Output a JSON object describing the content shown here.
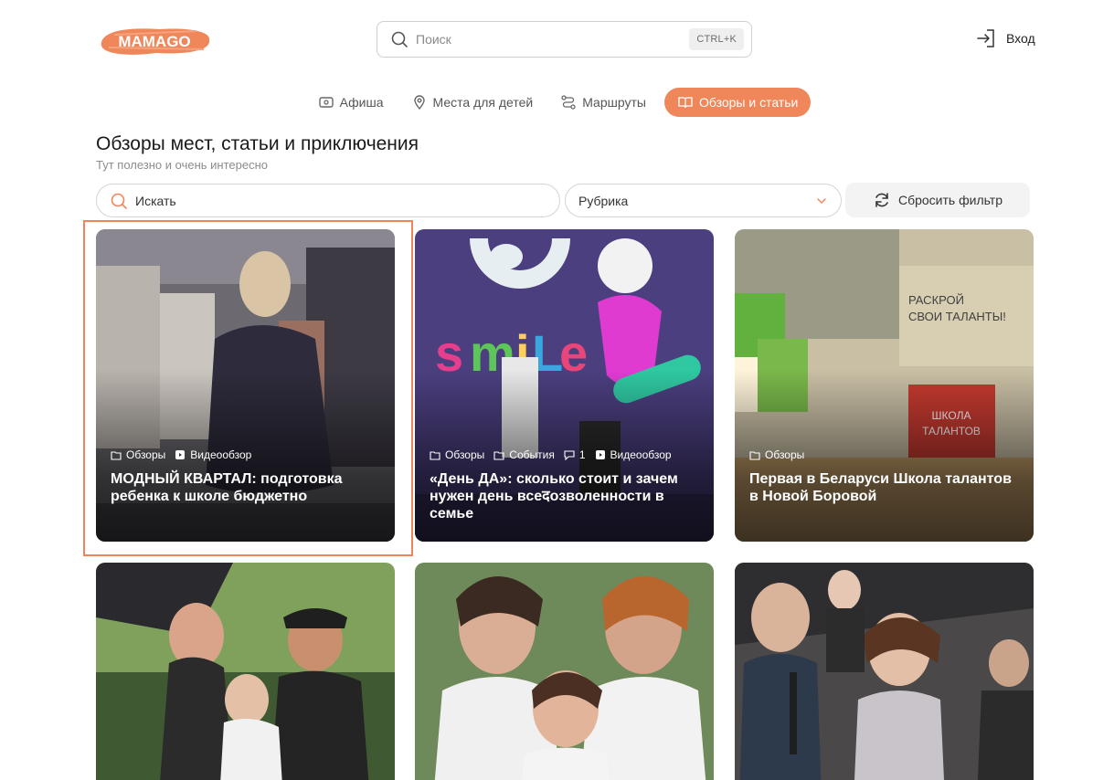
{
  "logo": {
    "text": "MAMAGO"
  },
  "search": {
    "placeholder": "Поиск",
    "shortcut": "CTRL+K"
  },
  "auth": {
    "login_label": "Вход"
  },
  "nav": {
    "tabs": [
      {
        "label": "Афиша",
        "icon": "ticket-icon",
        "active": false
      },
      {
        "label": "Места для детей",
        "icon": "map-pin-icon",
        "active": false
      },
      {
        "label": "Маршруты",
        "icon": "route-icon",
        "active": false
      },
      {
        "label": "Обзоры и статьи",
        "icon": "book-icon",
        "active": true
      }
    ]
  },
  "page": {
    "title": "Обзоры мест, статьи и приключения",
    "subtitle": "Тут полезно и очень интересно"
  },
  "filters": {
    "search_value": "Искать",
    "rubric_value": "Рубрика",
    "reset_label": "Сбросить фильтр"
  },
  "colors": {
    "accent": "#f0875a",
    "highlight": "#ee8457"
  },
  "cards": [
    {
      "tags": [
        "Обзоры",
        "Видеообзор"
      ],
      "title": "МОДНЫЙ КВАРТАЛ: подготовка ребенка к школе бюджетно"
    },
    {
      "tags": [
        "Обзоры",
        "События",
        "1",
        "Видеообзор"
      ],
      "title": "«День ДА»: сколько стоит и зачем нужен день всеदозволенности в семье"
    },
    {
      "tags": [
        "Обзоры"
      ],
      "title": "Первая в Беларуси Школа талантов в Новой Боровой"
    },
    {
      "tags": [],
      "title": ""
    },
    {
      "tags": [],
      "title": ""
    },
    {
      "tags": [],
      "title": ""
    }
  ]
}
